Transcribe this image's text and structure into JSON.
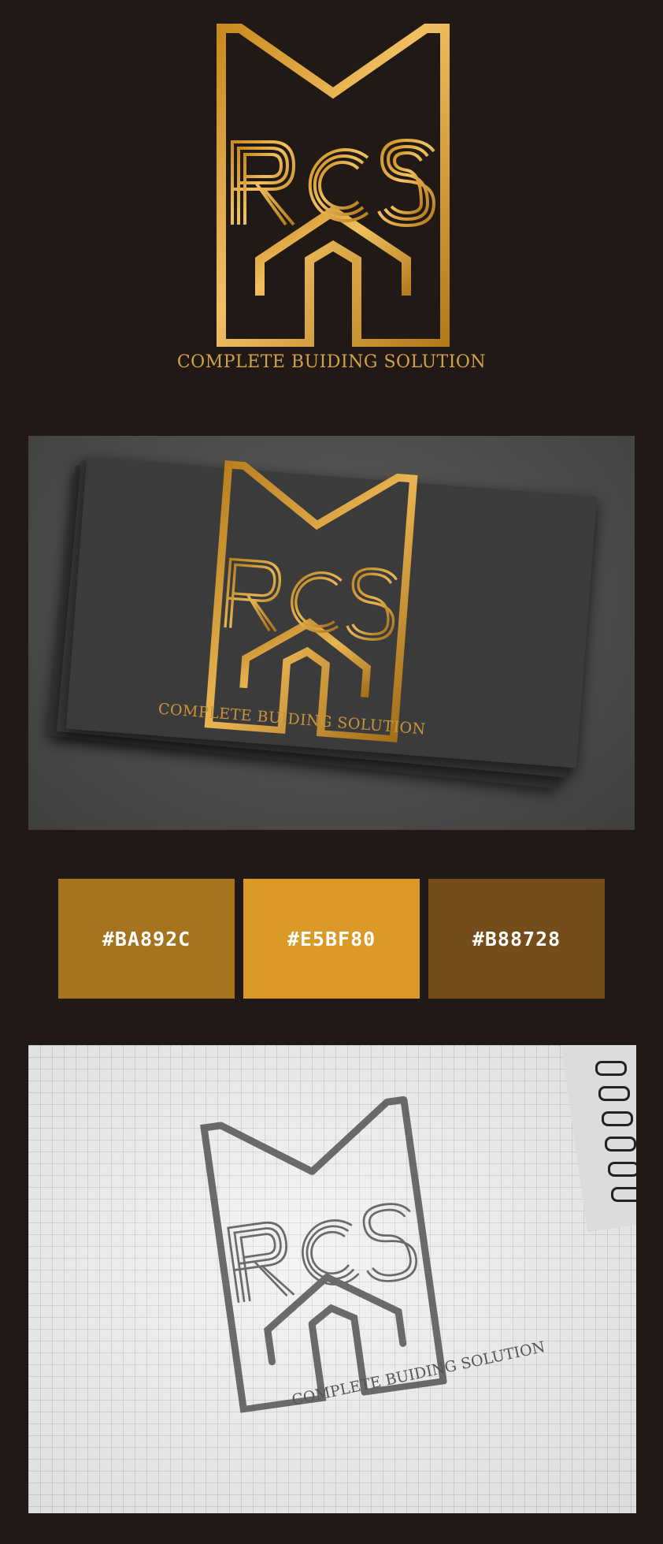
{
  "logo": {
    "monogram": "RCS",
    "tagline": "COMPLETE BUIDING SOLUTION"
  },
  "colors": {
    "background": "#211915",
    "gold_light": "#E8B24A",
    "gold_mid": "#D59B2B",
    "gold_dark": "#A9761F"
  },
  "palette": {
    "swatches": [
      {
        "label": "#BA892C",
        "color": "#A6741E"
      },
      {
        "label": "#E5BF80",
        "color": "#DB9A27"
      },
      {
        "label": "#B88728",
        "color": "#744D1A"
      }
    ]
  },
  "mockups": {
    "card": {
      "tagline": "COMPLETE BUIDING SOLUTION"
    },
    "sketch": {
      "tagline": "COMPLETE BUIDING SOLUTION"
    }
  }
}
